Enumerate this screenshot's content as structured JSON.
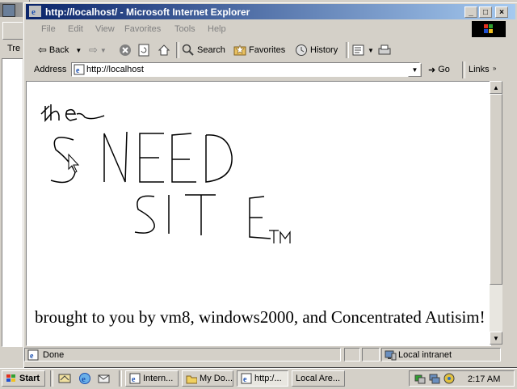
{
  "background_window": {
    "tree_label": "Tre"
  },
  "window": {
    "title": "http://localhost/ - Microsoft Internet Explorer",
    "controls": {
      "minimize": "_",
      "maximize": "□",
      "close": "×"
    }
  },
  "menu": [
    "File",
    "Edit",
    "View",
    "Favorites",
    "Tools",
    "Help"
  ],
  "toolbar": {
    "back": "Back",
    "search": "Search",
    "favorites": "Favorites",
    "history": "History"
  },
  "address": {
    "label": "Address",
    "url": "http://localhost",
    "go": "Go",
    "links": "Links"
  },
  "content": {
    "handwriting": {
      "line1": "the",
      "line2": "SNEED",
      "line3": "SITE",
      "mark": "TM"
    },
    "footer": "brought to you by vm8, windows2000, and Concentrated Autisim!"
  },
  "status": {
    "text": "Done",
    "zone": "Local intranet"
  },
  "taskbar": {
    "start": "Start",
    "tasks": [
      "Intern...",
      "My Do...",
      "http:/...",
      "Local Are..."
    ],
    "clock": "2:17 AM"
  },
  "colors": {
    "titlebar_start": "#0a246a",
    "titlebar_end": "#a6caf0",
    "chrome": "#d4d0c8"
  }
}
